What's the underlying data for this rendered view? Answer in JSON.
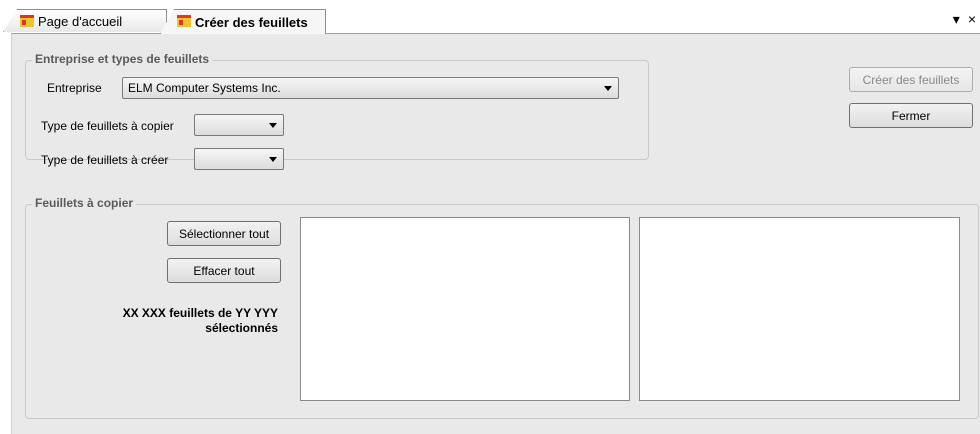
{
  "tabs": [
    {
      "label": "Page d'accueil",
      "active": false,
      "icon": "app-window-icon"
    },
    {
      "label": "Créer des feuillets",
      "active": true,
      "icon": "app-window-icon"
    }
  ],
  "window_controls": {
    "dropdown_glyph": "▾",
    "close_glyph": "×"
  },
  "group_company": {
    "legend": "Entreprise et types de feuillets",
    "company_label": "Entreprise",
    "company_value": "ELM Computer Systems Inc.",
    "copy_type_label": "Type de feuillets à copier",
    "copy_type_value": "",
    "create_type_label": "Type de feuillets à créer",
    "create_type_value": ""
  },
  "actions": {
    "create_label": "Créer des feuillets",
    "create_enabled": false,
    "close_label": "Fermer"
  },
  "group_copy": {
    "legend": "Feuillets à copier",
    "select_all_label": "Sélectionner tout",
    "clear_all_label": "Effacer tout",
    "count_line1": "XX XXX feuillets de YY YYY",
    "count_line2": "sélectionnés"
  },
  "colors": {
    "panel_bg": "#e9e9e9",
    "tab_icon_red": "#d9372a",
    "tab_icon_yellow": "#f2c12e"
  }
}
